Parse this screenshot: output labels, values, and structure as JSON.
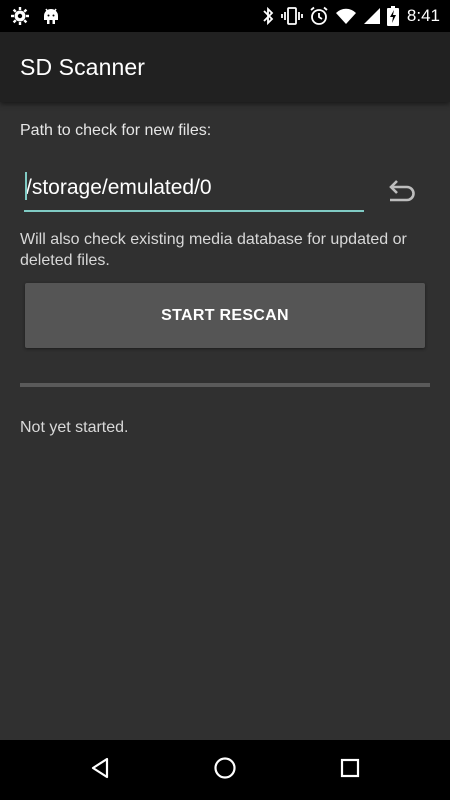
{
  "status_bar": {
    "time": "8:41",
    "left_icons": [
      "settings-icon",
      "android-debug-icon"
    ],
    "right_icons": [
      "bluetooth-icon",
      "vibrate-icon",
      "alarm-icon",
      "wifi-icon",
      "cell-signal-icon",
      "battery-charging-icon"
    ]
  },
  "app_bar": {
    "title": "SD Scanner"
  },
  "main": {
    "path_label": "Path to check for new files:",
    "path_value": "/storage/emulated/0",
    "undo_icon": "undo-icon",
    "note": "Will also check existing media database for updated or deleted files.",
    "rescan_label": "START RESCAN",
    "progress": 0,
    "status": "Not yet started."
  },
  "nav_bar": {
    "icons": [
      "back-icon",
      "home-icon",
      "recents-icon"
    ]
  },
  "colors": {
    "background": "#303030",
    "app_bar": "#212121",
    "accent": "#80cbc4",
    "button": "#555555"
  }
}
